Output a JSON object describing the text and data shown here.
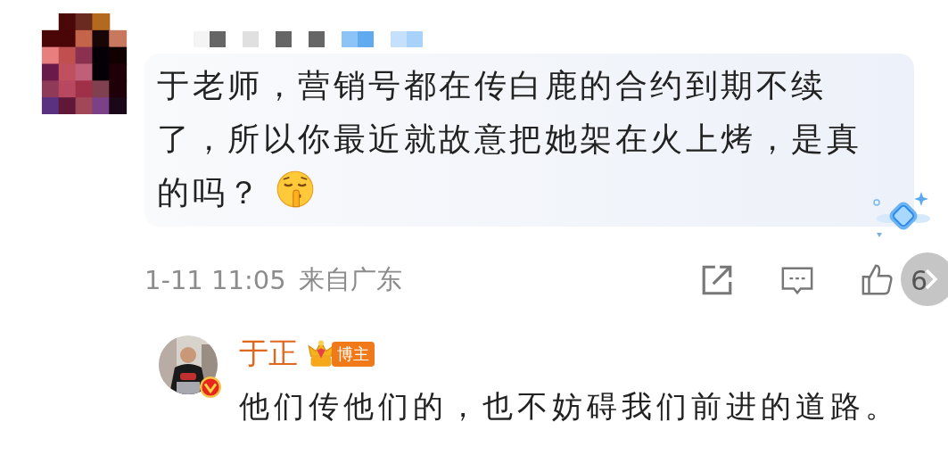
{
  "comment": {
    "text": "于老师，营销号都在传白鹿的合约到期不续了，所以你最近就故意把她架在火上烤，是真的吗？",
    "time": "1-11 11:05",
    "location": "来自广东",
    "like_count": "6"
  },
  "reply": {
    "author": "于正",
    "badge": "博主",
    "verified": true,
    "text": "他们传他们的，也不妨碍我们前进的道路。"
  }
}
